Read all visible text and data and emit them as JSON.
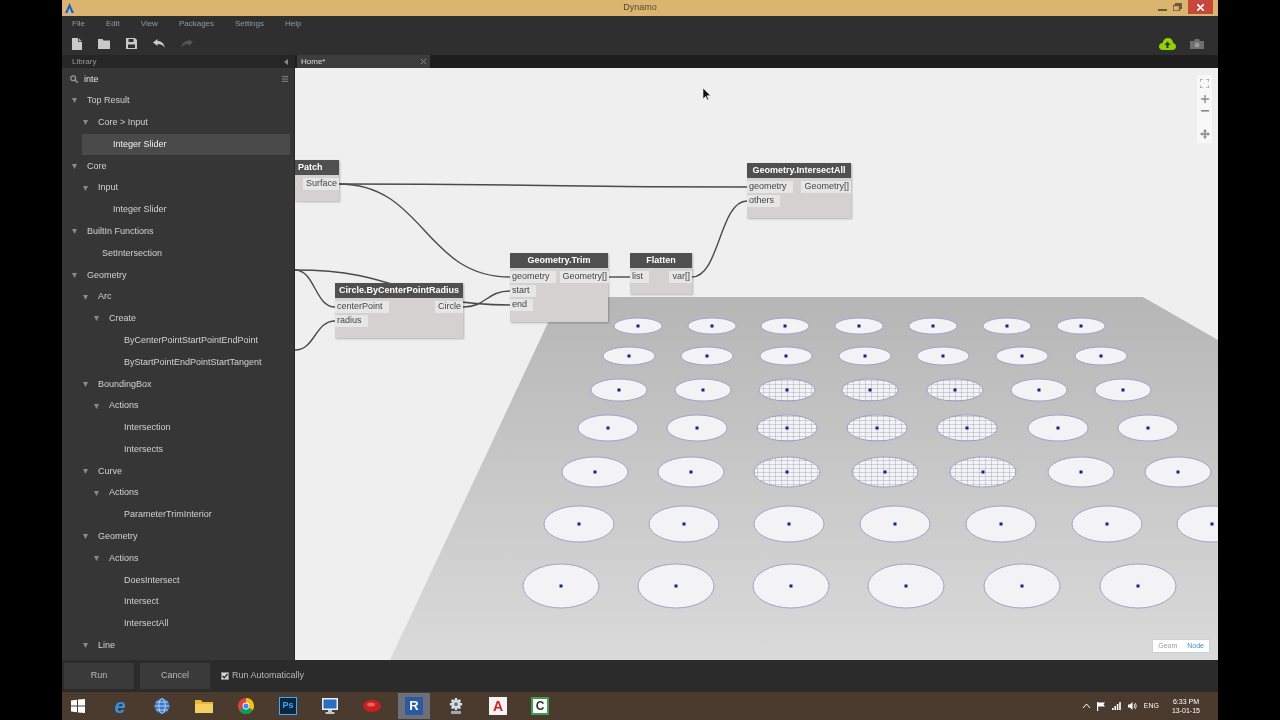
{
  "window": {
    "title": "Dynamo"
  },
  "menu": [
    "File",
    "Edit",
    "View",
    "Packages",
    "Settings",
    "Help"
  ],
  "toolbar": [
    {
      "kind": "new",
      "disabled": false
    },
    {
      "kind": "open",
      "disabled": false
    },
    {
      "kind": "save",
      "disabled": false
    },
    {
      "kind": "undo",
      "disabled": false
    },
    {
      "kind": "redo",
      "disabled": true
    }
  ],
  "library": {
    "title": "Library",
    "search": {
      "value": "inte"
    },
    "tree": [
      {
        "label": "Top Result",
        "expanded": true,
        "selected": false,
        "children": [
          {
            "label": "Core > Input",
            "expanded": true,
            "selected": false,
            "children": [
              {
                "label": "Integer Slider",
                "selected": true
              }
            ]
          }
        ]
      },
      {
        "label": "Core",
        "expanded": true,
        "selected": false,
        "children": [
          {
            "label": "Input",
            "expanded": true,
            "selected": false,
            "children": [
              {
                "label": "Integer Slider",
                "selected": false
              }
            ]
          }
        ]
      },
      {
        "label": "BuiltIn Functions",
        "expanded": true,
        "selected": false,
        "children": [
          {
            "label": "SetIntersection",
            "selected": false
          }
        ]
      },
      {
        "label": "Geometry",
        "expanded": true,
        "selected": false,
        "children": [
          {
            "label": "Arc",
            "expanded": true,
            "selected": false,
            "children": [
              {
                "label": "Create",
                "expanded": true,
                "selected": false,
                "children": [
                  {
                    "label": "ByCenterPointStartPointEndPoint",
                    "selected": false
                  },
                  {
                    "label": "ByStartPointEndPointStartTangent",
                    "selected": false
                  }
                ]
              }
            ]
          },
          {
            "label": "BoundingBox",
            "expanded": true,
            "selected": false,
            "children": [
              {
                "label": "Actions",
                "expanded": true,
                "selected": false,
                "children": [
                  {
                    "label": "Intersection",
                    "selected": false
                  },
                  {
                    "label": "Intersects",
                    "selected": false
                  }
                ]
              }
            ]
          },
          {
            "label": "Curve",
            "expanded": true,
            "selected": false,
            "children": [
              {
                "label": "Actions",
                "expanded": true,
                "selected": false,
                "children": [
                  {
                    "label": "ParameterTrimInterior",
                    "selected": false
                  }
                ]
              }
            ]
          },
          {
            "label": "Geometry",
            "expanded": true,
            "selected": false,
            "children": [
              {
                "label": "Actions",
                "expanded": true,
                "selected": false,
                "children": [
                  {
                    "label": "DoesIntersect",
                    "selected": false
                  },
                  {
                    "label": "Intersect",
                    "selected": false
                  },
                  {
                    "label": "IntersectAll",
                    "selected": false
                  }
                ]
              }
            ]
          },
          {
            "label": "Line",
            "expanded": true,
            "selected": false
          }
        ]
      }
    ]
  },
  "tabs": [
    {
      "label": "Home*",
      "selected": true
    }
  ],
  "nodes": [
    {
      "title": "Patch",
      "outputs": [
        "Surface"
      ]
    },
    {
      "title": "Circle.ByCenterPointRadius",
      "inputs": [
        "centerPoint",
        "radius"
      ],
      "outputs": [
        "Circle"
      ]
    },
    {
      "title": "Geometry.Trim",
      "inputs": [
        "geometry",
        "start",
        "end"
      ],
      "outputs": [
        "Geometry[]"
      ]
    },
    {
      "title": "Flatten",
      "inputs": [
        "list"
      ],
      "outputs": [
        "var[]"
      ]
    },
    {
      "title": "Geometry.IntersectAll",
      "inputs": [
        "geometry",
        "others"
      ],
      "outputs": [
        "Geometry[]"
      ]
    }
  ],
  "view_toggle": [
    {
      "label": "Geom",
      "selected": false
    },
    {
      "label": "Node",
      "selected": true
    }
  ],
  "run_bar": {
    "run_label": "Run",
    "cancel_label": "Cancel",
    "auto_run": {
      "label": "Run Automatically",
      "checked": true
    }
  },
  "taskbar": {
    "apps": [
      {
        "kind": "start",
        "selected": false
      },
      {
        "kind": "ie",
        "glyph": "e",
        "selected": false
      },
      {
        "kind": "globe",
        "selected": false
      },
      {
        "kind": "folder",
        "selected": false
      },
      {
        "kind": "round-logo",
        "selected": false
      },
      {
        "kind": "ps",
        "glyph": "Ps",
        "selected": false
      },
      {
        "kind": "monitor",
        "selected": false
      },
      {
        "kind": "disc",
        "selected": false
      },
      {
        "kind": "revit",
        "glyph": "R",
        "selected": true
      },
      {
        "kind": "gear",
        "selected": false
      },
      {
        "kind": "autodesk",
        "glyph": "A",
        "selected": false
      },
      {
        "kind": "camtasia",
        "glyph": "C",
        "selected": false
      }
    ],
    "language": "ENG",
    "time": "6:33 PM",
    "date": "13-01-15"
  }
}
